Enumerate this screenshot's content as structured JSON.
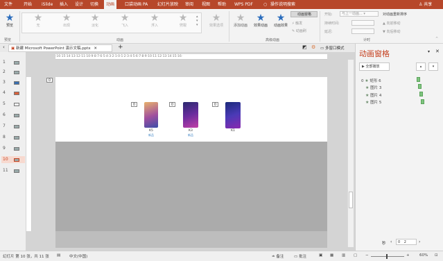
{
  "menu": {
    "items": [
      "文件",
      "开始",
      "iSlide",
      "插入",
      "设计",
      "切换",
      "动画",
      "口袋动画 PA",
      "幻灯片放映",
      "审阅",
      "视图",
      "帮助",
      "WPS PDF",
      "操作说明搜索"
    ],
    "share": "共享"
  },
  "ribbon": {
    "preview_label": "预览",
    "preview_group": "预览",
    "animation_group": "动画",
    "gallery": [
      "无",
      "出现",
      "淡化",
      "飞入",
      "浮入",
      "劈裂"
    ],
    "effect_options": "效果选项",
    "add_animation": "添加动画",
    "animation_painter": "动画刷",
    "trigger": "触发",
    "animation_pane_btn": "动画窗格",
    "advanced_group": "高级动画",
    "start_label": "开始:",
    "start_value": "与上一动画...",
    "duration_label": "持续时间:",
    "delay_label": "延迟:",
    "reorder_title": "对动画重新排序",
    "move_earlier": "向前移动",
    "move_later": "向后移动",
    "timing_group": "计时",
    "second_icon_label": "动画效果",
    "add_effect_label": "效果动画"
  },
  "tabs": {
    "doc_tab": "新建 Microsoft PowerPoint 演示文稿.pptx",
    "multi_window": "多窗口模式"
  },
  "ruler": {
    "marks": "·16·15·14·13·12·11·10·9·8·7·6·5·4·3·2·1·0·1·2·3·4·5·6·7·8·9·10·11·12·13·14·15·16·"
  },
  "thumbnails": [
    "1",
    "2",
    "3",
    "4",
    "5",
    "6",
    "7",
    "8",
    "9",
    "10",
    "11"
  ],
  "active_thumbnail": "10",
  "slide": {
    "tag_slide": "0",
    "phones": [
      {
        "tag": "0",
        "name": "K5",
        "sub": "新品"
      },
      {
        "tag": "0",
        "name": "K3",
        "sub": "新品"
      },
      {
        "tag": "0",
        "name": "K1",
        "sub": ""
      }
    ]
  },
  "pane": {
    "title": "动画窗格",
    "play_all": "全部播放",
    "rows": [
      {
        "index": "0",
        "name": "矩形 6"
      },
      {
        "index": "",
        "name": "图片 3"
      },
      {
        "index": "",
        "name": "图片 4"
      },
      {
        "index": "",
        "name": "图片 5"
      }
    ],
    "seconds_label": "秒",
    "seconds_value": "0",
    "seconds_max": "2"
  },
  "status": {
    "slide_info": "幻灯片 第 10 张，共 11 张",
    "language": "中文(中国)",
    "notes": "备注",
    "comments": "批注",
    "zoom": "60%"
  },
  "colors": {
    "brand": "#b7472a",
    "accent": "#c43e1c",
    "timeline_bar": "#7fc47f"
  }
}
